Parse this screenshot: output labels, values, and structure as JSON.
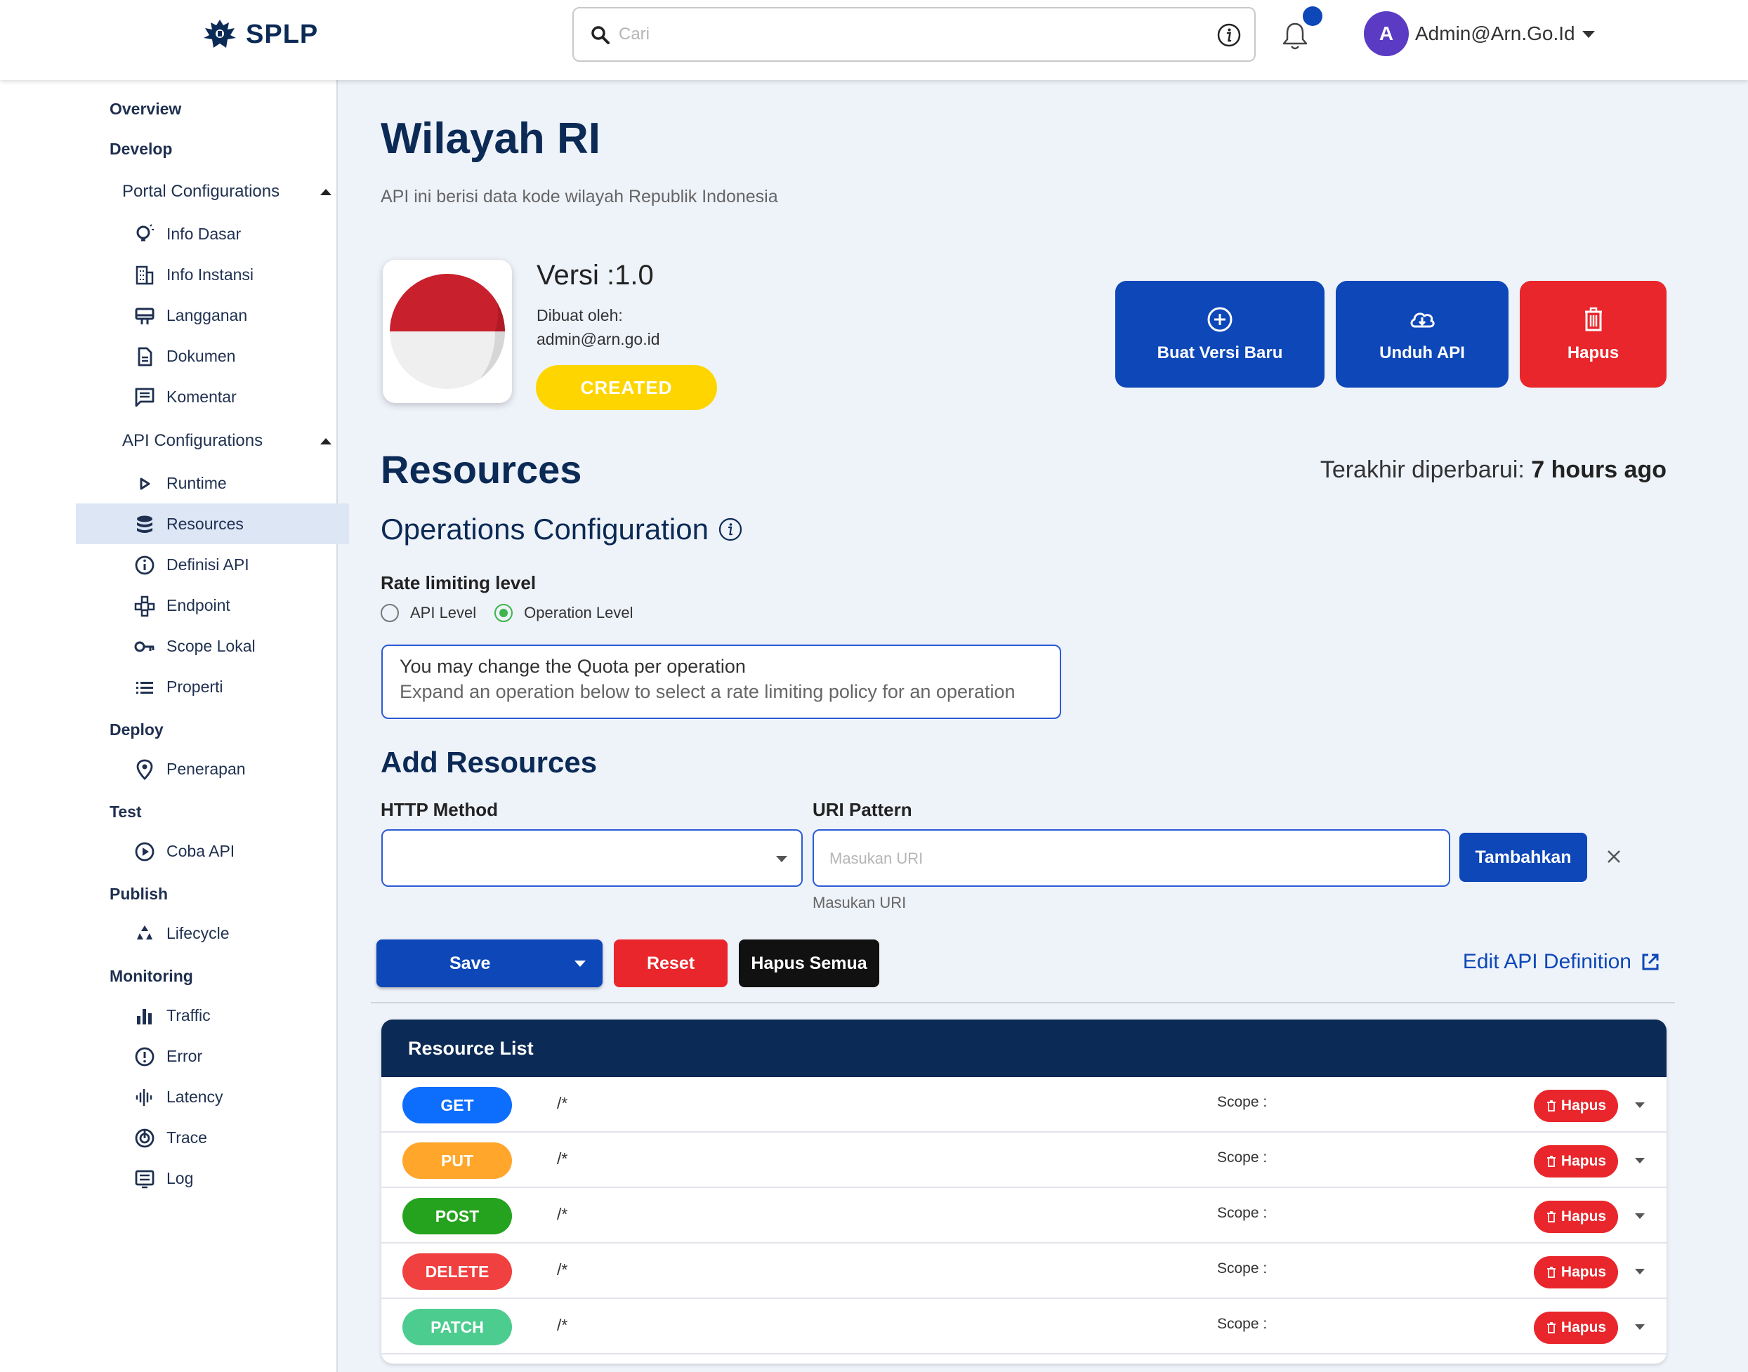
{
  "header": {
    "brand": "SPLP",
    "search_placeholder": "Cari",
    "user_initial": "A",
    "user_name": "Admin@Arn.Go.Id"
  },
  "sidebar": {
    "overview": "Overview",
    "develop": "Develop",
    "portal_configurations": "Portal Configurations",
    "info_dasar": "Info Dasar",
    "info_instansi": "Info Instansi",
    "langganan": "Langganan",
    "dokumen": "Dokumen",
    "komentar": "Komentar",
    "api_configurations": "API Configurations",
    "runtime": "Runtime",
    "resources": "Resources",
    "definisi_api": "Definisi API",
    "endpoint": "Endpoint",
    "scope_lokal": "Scope Lokal",
    "properti": "Properti",
    "deploy": "Deploy",
    "penerapan": "Penerapan",
    "test": "Test",
    "coba_api": "Coba API",
    "publish": "Publish",
    "lifecycle": "Lifecycle",
    "monitoring": "Monitoring",
    "traffic": "Traffic",
    "error": "Error",
    "latency": "Latency",
    "trace": "Trace",
    "log": "Log"
  },
  "api": {
    "title": "Wilayah RI",
    "description": "API ini berisi data kode wilayah Republik Indonesia",
    "version": "Versi :1.0",
    "created_by_label": "Dibuat oleh:",
    "created_by": "admin@arn.go.id",
    "status": "CREATED"
  },
  "actions": {
    "new_version": "Buat Versi Baru",
    "download": "Unduh API",
    "delete": "Hapus"
  },
  "resources": {
    "heading": "Resources",
    "updated_label": "Terakhir diperbarui:",
    "updated_value": "7 hours ago",
    "ops_heading": "Operations Configuration",
    "rate_label": "Rate limiting level",
    "api_level": "API Level",
    "operation_level": "Operation Level",
    "selected_level": "Operation Level",
    "info_line1": "You may change the Quota per operation",
    "info_line2": "Expand an operation below to select a rate limiting policy for an operation"
  },
  "add": {
    "heading": "Add Resources",
    "method_label": "HTTP Method",
    "uri_label": "URI Pattern",
    "uri_placeholder": "Masukan URI",
    "uri_help": "Masukan URI",
    "add_button": "Tambahkan"
  },
  "toolbar": {
    "save": "Save",
    "reset": "Reset",
    "clear_all": "Hapus Semua",
    "edit_definition": "Edit API Definition"
  },
  "resource_list": {
    "title": "Resource List",
    "rows": [
      {
        "method": "GET",
        "path": "/*",
        "scope": "Scope :",
        "delete": "Hapus",
        "color": "#0d6efd"
      },
      {
        "method": "PUT",
        "path": "/*",
        "scope": "Scope :",
        "delete": "Hapus",
        "color": "#ffa62b"
      },
      {
        "method": "POST",
        "path": "/*",
        "scope": "Scope :",
        "delete": "Hapus",
        "color": "#25a21e"
      },
      {
        "method": "DELETE",
        "path": "/*",
        "scope": "Scope :",
        "delete": "Hapus",
        "color": "#f04040"
      },
      {
        "method": "PATCH",
        "path": "/*",
        "scope": "Scope :",
        "delete": "Hapus",
        "color": "#4ccc8f"
      }
    ]
  },
  "colors": {
    "primary": "#0d47b8",
    "danger": "#e8262b",
    "navy": "#0b2a55",
    "status_created": "#ffd500",
    "radio_selected": "#3db54a"
  }
}
